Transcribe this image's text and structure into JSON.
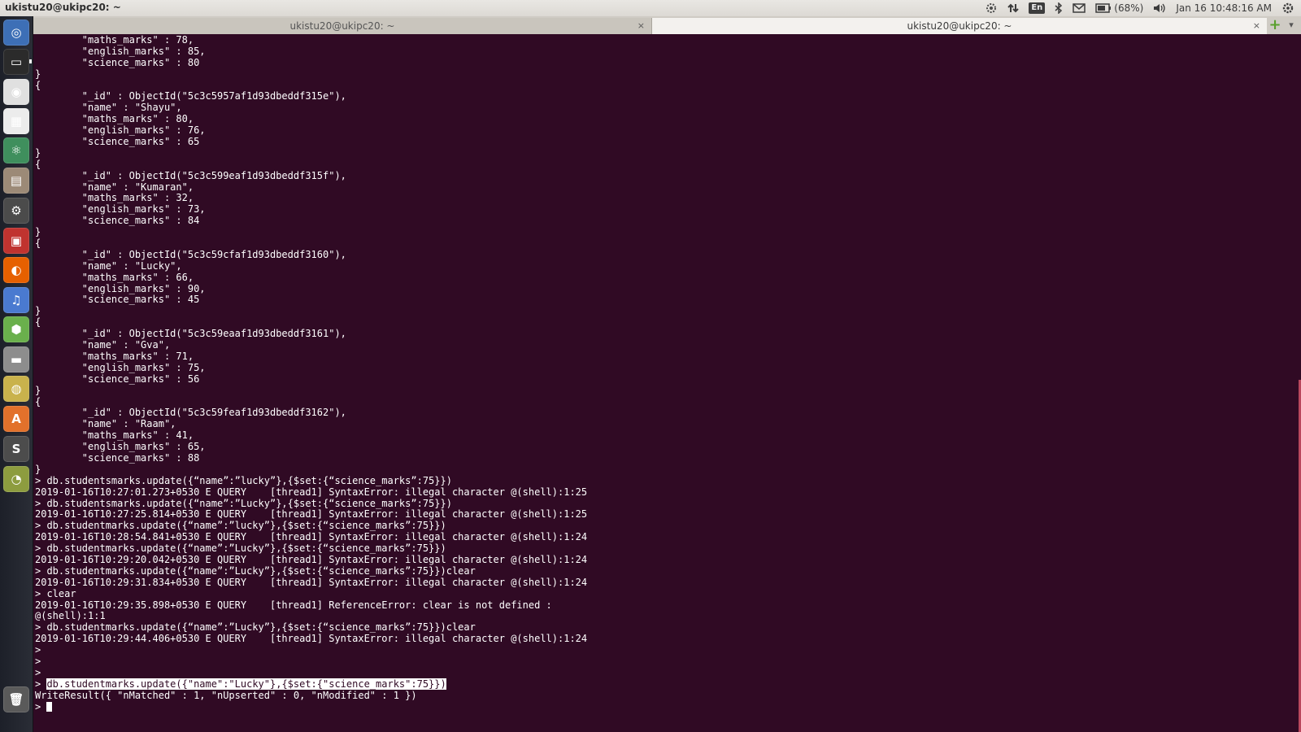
{
  "top_panel": {
    "title": "ukistu20@ukipc20: ~",
    "keyboard_layout": "En",
    "battery": "(68%)",
    "clock": "Jan 16 10:48:16 AM"
  },
  "launcher": {
    "items": [
      {
        "icon": "ubuntu-dash-icon",
        "color": "#3d6fb6"
      },
      {
        "icon": "terminal-icon",
        "color": "#2b2b2b"
      },
      {
        "icon": "chrome-icon",
        "color": "#e0e0e0"
      },
      {
        "icon": "system-monitor-icon",
        "color": "#ececec"
      },
      {
        "icon": "atom-icon",
        "color": "#3f8f5d"
      },
      {
        "icon": "file-manager-icon",
        "color": "#9c8a77"
      },
      {
        "icon": "system-settings-icon",
        "color": "#4b4b4b"
      },
      {
        "icon": "pdf-viewer-icon",
        "color": "#c0332f"
      },
      {
        "icon": "firefox-icon",
        "color": "#e66000"
      },
      {
        "icon": "music-player-icon",
        "color": "#4a7ad0"
      },
      {
        "icon": "android-studio-icon",
        "color": "#6ab04c"
      },
      {
        "icon": "disk-drive-icon",
        "color": "#8d8d8d"
      },
      {
        "icon": "optical-drive-icon",
        "color": "#c9b24c"
      },
      {
        "icon": "software-center-icon",
        "color": "#e2712b"
      },
      {
        "icon": "sublime-text-icon",
        "color": "#4c4c4c"
      },
      {
        "icon": "image-viewer-icon",
        "color": "#8d9c3f"
      },
      {
        "icon": "trash-icon",
        "color": "#5a5a5a"
      }
    ]
  },
  "tabs": [
    {
      "label": "ukistu20@ukipc20: ~",
      "close": "×",
      "active": false
    },
    {
      "label": "ukistu20@ukipc20: ~",
      "close": "×",
      "active": true
    }
  ],
  "new_tab_glyph": "+",
  "tab_menu_glyph": "▾",
  "terminal": {
    "lines": [
      "        \"maths_marks\" : 78,",
      "        \"english_marks\" : 85,",
      "        \"science_marks\" : 80",
      "}",
      "{",
      "        \"_id\" : ObjectId(\"5c3c5957af1d93dbeddf315e\"),",
      "        \"name\" : \"Shayu\",",
      "        \"maths_marks\" : 80,",
      "        \"english_marks\" : 76,",
      "        \"science_marks\" : 65",
      "}",
      "{",
      "        \"_id\" : ObjectId(\"5c3c599eaf1d93dbeddf315f\"),",
      "        \"name\" : \"Kumaran\",",
      "        \"maths_marks\" : 32,",
      "        \"english_marks\" : 73,",
      "        \"science_marks\" : 84",
      "}",
      "{",
      "        \"_id\" : ObjectId(\"5c3c59cfaf1d93dbeddf3160\"),",
      "        \"name\" : \"Lucky\",",
      "        \"maths_marks\" : 66,",
      "        \"english_marks\" : 90,",
      "        \"science_marks\" : 45",
      "}",
      "{",
      "        \"_id\" : ObjectId(\"5c3c59eaaf1d93dbeddf3161\"),",
      "        \"name\" : \"Gva\",",
      "        \"maths_marks\" : 71,",
      "        \"english_marks\" : 75,",
      "        \"science_marks\" : 56",
      "}",
      "{",
      "        \"_id\" : ObjectId(\"5c3c59feaf1d93dbeddf3162\"),",
      "        \"name\" : \"Raam\",",
      "        \"maths_marks\" : 41,",
      "        \"english_marks\" : 65,",
      "        \"science_marks\" : 88",
      "}",
      "> db.studentsmarks.update({“name”:”lucky”},{$set:{“science_marks”:75}})",
      "2019-01-16T10:27:01.273+0530 E QUERY    [thread1] SyntaxError: illegal character @(shell):1:25",
      "> db.studentsmarks.update({“name”:”Lucky”},{$set:{“science_marks”:75}})",
      "2019-01-16T10:27:25.814+0530 E QUERY    [thread1] SyntaxError: illegal character @(shell):1:25",
      "> db.studentmarks.update({“name”:”lucky”},{$set:{“science_marks”:75}})",
      "2019-01-16T10:28:54.841+0530 E QUERY    [thread1] SyntaxError: illegal character @(shell):1:24",
      "> db.studentmarks.update({“name”:”Lucky”},{$set:{“science_marks”:75}})",
      "2019-01-16T10:29:20.042+0530 E QUERY    [thread1] SyntaxError: illegal character @(shell):1:24",
      "> db.studentmarks.update({“name”:”Lucky”},{$set:{“science_marks”:75}})clear",
      "2019-01-16T10:29:31.834+0530 E QUERY    [thread1] SyntaxError: illegal character @(shell):1:24",
      "> clear",
      "2019-01-16T10:29:35.898+0530 E QUERY    [thread1] ReferenceError: clear is not defined :",
      "@(shell):1:1",
      "> db.studentmarks.update({“name”:”Lucky”},{$set:{“science_marks”:75}})clear",
      "2019-01-16T10:29:44.406+0530 E QUERY    [thread1] SyntaxError: illegal character @(shell):1:24",
      ">",
      ">",
      ">",
      "> ",
      "WriteResult({ \"nMatched\" : 1, \"nUpserted\" : 0, \"nModified\" : 1 })",
      "> "
    ],
    "highlighted_command": "db.studentmarks.update({\"name\":\"Lucky\"},{$set:{\"science_marks\":75}})"
  }
}
